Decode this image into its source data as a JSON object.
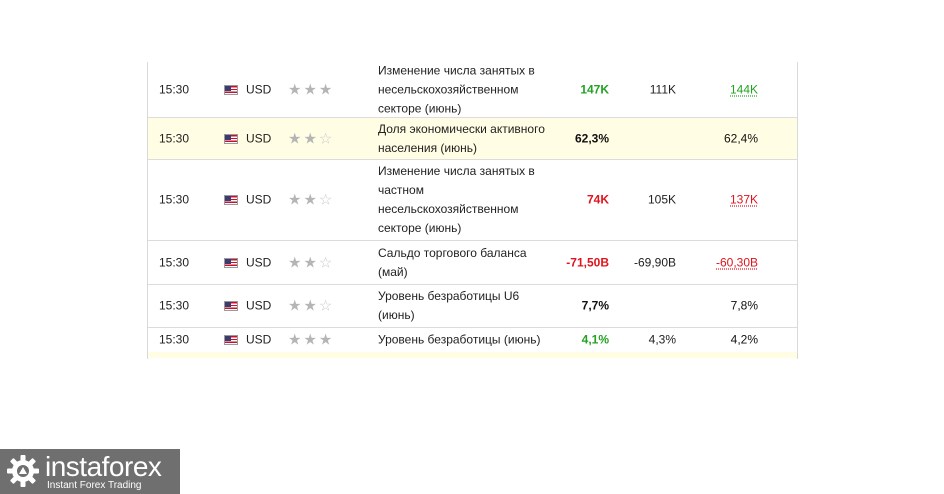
{
  "rows": [
    {
      "time": "15:30",
      "currency": "USD",
      "stars": "★★★",
      "stars_off": "",
      "event": "Изменение числа занятых в несельскохозяйственном секторе (июнь)",
      "actual": "147K",
      "actual_color": "green",
      "forecast": "111K",
      "previous": "144K",
      "previous_color": "green",
      "highlight": false
    },
    {
      "time": "15:30",
      "currency": "USD",
      "stars": "★★",
      "stars_off": "☆",
      "event": "Доля экономически активного населения (июнь)",
      "actual": "62,3%",
      "actual_color": "black",
      "forecast": "",
      "previous": "62,4%",
      "previous_color": "black",
      "highlight": true
    },
    {
      "time": "15:30",
      "currency": "USD",
      "stars": "★★",
      "stars_off": "☆",
      "event": "Изменение числа занятых в частном несельскохозяйственном секторе (июнь)",
      "actual": "74K",
      "actual_color": "red",
      "forecast": "105K",
      "previous": "137K",
      "previous_color": "red",
      "highlight": false
    },
    {
      "time": "15:30",
      "currency": "USD",
      "stars": "★★",
      "stars_off": "☆",
      "event": "Сальдо торгового баланса (май)",
      "actual": "-71,50B",
      "actual_color": "red",
      "forecast": "-69,90B",
      "previous": "-60,30B",
      "previous_color": "red",
      "highlight": false
    },
    {
      "time": "15:30",
      "currency": "USD",
      "stars": "★★",
      "stars_off": "☆",
      "event": "Уровень безработицы U6 (июнь)",
      "actual": "7,7%",
      "actual_color": "black",
      "forecast": "",
      "previous": "7,8%",
      "previous_color": "black",
      "highlight": false
    },
    {
      "time": "15:30",
      "currency": "USD",
      "stars": "★★★",
      "stars_off": "",
      "event": "Уровень безработицы (июнь)",
      "actual": "4,1%",
      "actual_color": "green",
      "forecast": "4,3%",
      "previous": "4,2%",
      "previous_color": "black",
      "highlight": false
    }
  ],
  "logo": {
    "name": "instaforex",
    "tagline": "Instant Forex Trading"
  },
  "colors": {
    "green": "#22a322",
    "red": "#e0141e",
    "highlight": "#fffde3"
  }
}
